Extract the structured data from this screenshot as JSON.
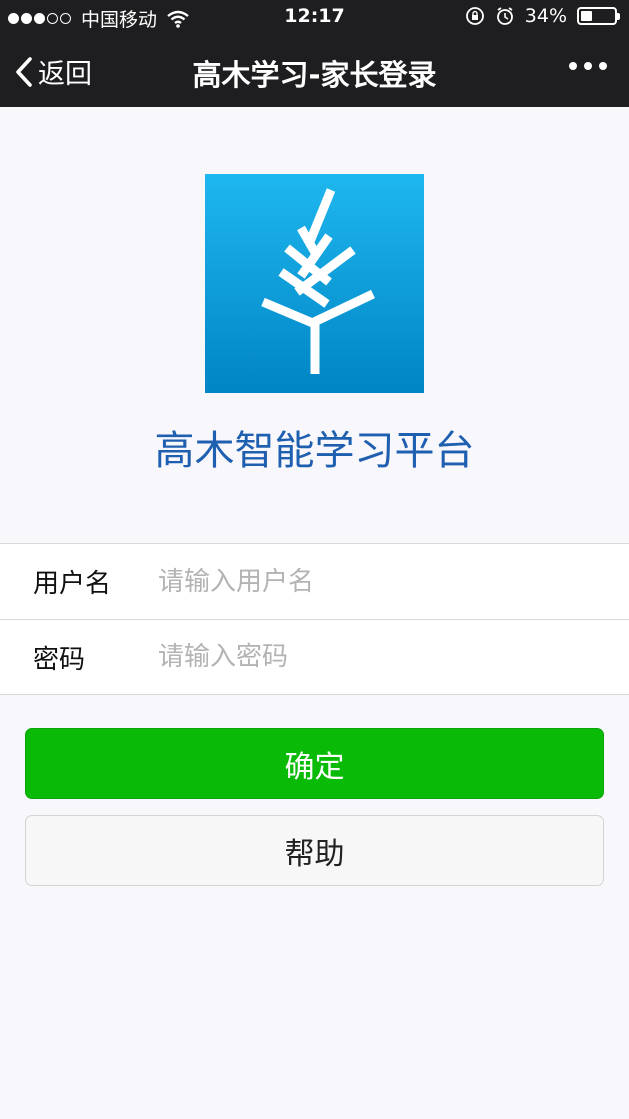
{
  "status_bar": {
    "signal_filled": 3,
    "signal_total": 5,
    "carrier": "中国移动",
    "time": "12:17",
    "battery_percent": "34%",
    "battery_level": 0.34,
    "icons": [
      "wifi-icon",
      "rotation-lock-icon",
      "alarm-icon",
      "battery-icon"
    ]
  },
  "nav": {
    "back_label": "返回",
    "title": "高木学习-家长登录",
    "more_icon": "more-dots-icon"
  },
  "brand": {
    "logo_icon": "tree-logo-icon",
    "app_name": "高木智能学习平台",
    "name_color": "#1f5fb0",
    "logo_colors": [
      "#1fb7ef",
      "#0085c4"
    ]
  },
  "form": {
    "username_label": "用户名",
    "username_placeholder": "请输入用户名",
    "username_value": "",
    "password_label": "密码",
    "password_placeholder": "请输入密码",
    "password_value": ""
  },
  "actions": {
    "confirm_label": "确定",
    "help_label": "帮助",
    "confirm_color": "#09bb07"
  }
}
